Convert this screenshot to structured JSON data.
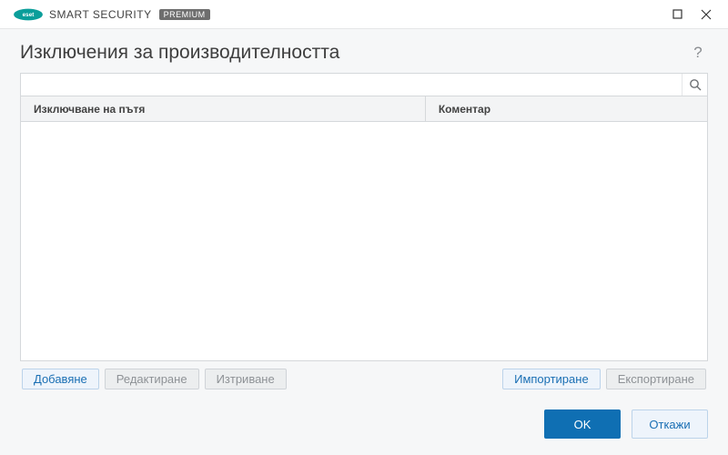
{
  "brand": {
    "name": "SMART SECURITY",
    "badge": "PREMIUM"
  },
  "header": {
    "title": "Изключения за производителността"
  },
  "search": {
    "value": "",
    "placeholder": ""
  },
  "table": {
    "columns": {
      "path": "Изключване на пътя",
      "comment": "Коментар"
    },
    "rows": []
  },
  "toolbar": {
    "add": "Добавяне",
    "edit": "Редактиране",
    "delete": "Изтриване",
    "import": "Импортиране",
    "export": "Експортиране"
  },
  "footer": {
    "ok": "OK",
    "cancel": "Откажи"
  }
}
